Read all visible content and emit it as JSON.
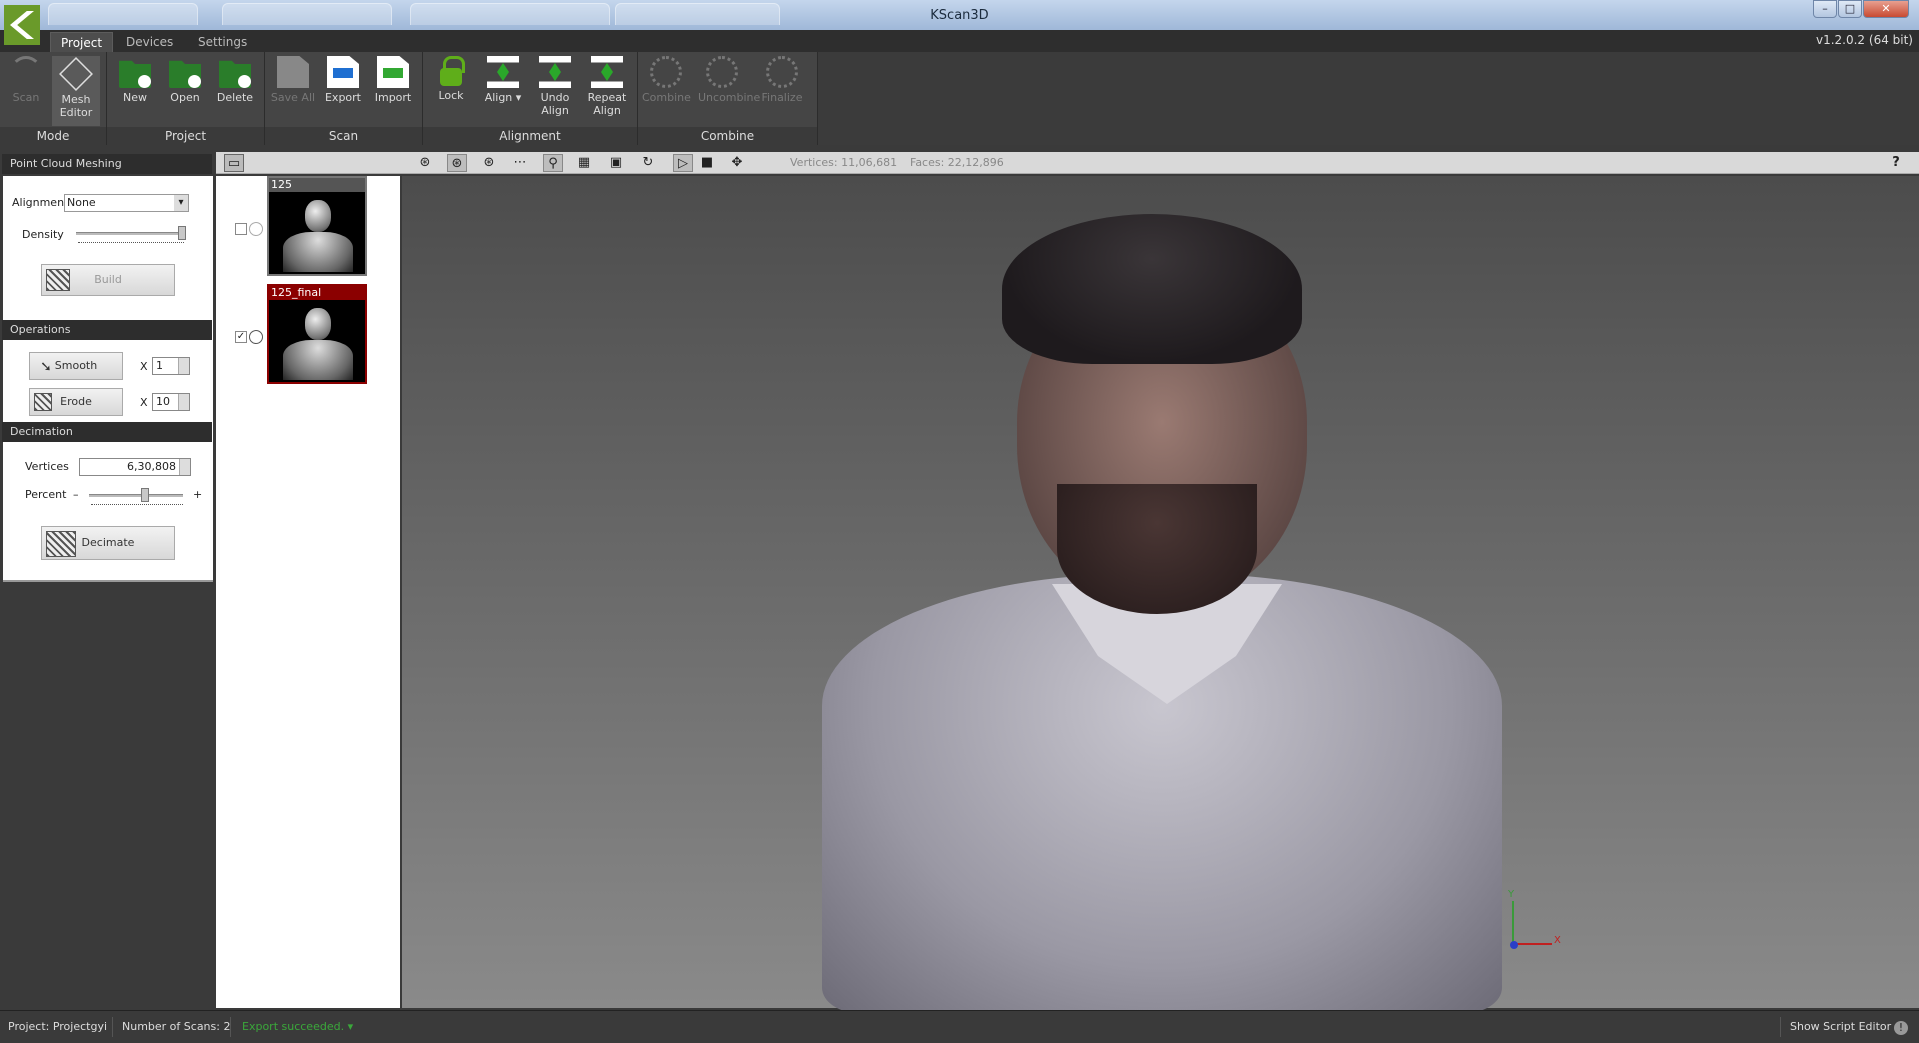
{
  "window": {
    "title": "KScan3D",
    "minimize": "–",
    "maximize": "□",
    "close": "✕"
  },
  "menu": {
    "tabs": [
      "Project",
      "Devices",
      "Settings"
    ],
    "active": "Project",
    "version": "v1.2.0.2 (64 bit)"
  },
  "ribbon": {
    "mode": {
      "label": "Mode",
      "scan": "Scan",
      "mesh_editor": "Mesh Editor"
    },
    "project": {
      "label": "Project",
      "new": "New",
      "open": "Open",
      "delete": "Delete"
    },
    "scan": {
      "label": "Scan",
      "save_all": "Save All",
      "export": "Export",
      "import": "Import"
    },
    "alignment": {
      "label": "Alignment",
      "lock": "Lock",
      "align": "Align ▾",
      "undo_align": "Undo Align",
      "repeat_align": "Repeat Align"
    },
    "combine": {
      "label": "Combine",
      "combine": "Combine",
      "uncombine": "Uncombine",
      "finalize": "Finalize"
    }
  },
  "panel": {
    "meshing": {
      "title": "Point Cloud Meshing",
      "alignment_label": "Alignment",
      "alignment_value": "None",
      "density_label": "Density",
      "density_value": 1.0,
      "build": "Build"
    },
    "operations": {
      "title": "Operations",
      "smooth": "Smooth",
      "smooth_x": "X",
      "smooth_count": "1",
      "erode": "Erode",
      "erode_x": "X",
      "erode_count": "10"
    },
    "decimation": {
      "title": "Decimation",
      "vertices_label": "Vertices",
      "vertices_value": "6,30,808",
      "percent_label": "Percent",
      "minus": "–",
      "plus": "+",
      "percent_value": 0.6,
      "decimate": "Decimate"
    }
  },
  "scans": [
    {
      "name": "125",
      "checked": false,
      "selected": false
    },
    {
      "name": "125_final",
      "checked": true,
      "selected": true
    }
  ],
  "viewport": {
    "vertices": "Vertices: 11,06,681",
    "faces": "Faces: 22,12,896",
    "help": "?",
    "axis_x": "X",
    "axis_y": "Y"
  },
  "status": {
    "project": "Project: Projectgyi",
    "scans": "Number of Scans: 2",
    "message": "Export succeeded. ▾",
    "script_editor": "Show Script Editor",
    "info_icon": "!"
  },
  "colors": {
    "accent_green": "#3aa83a",
    "selection_red": "#8b0000"
  }
}
